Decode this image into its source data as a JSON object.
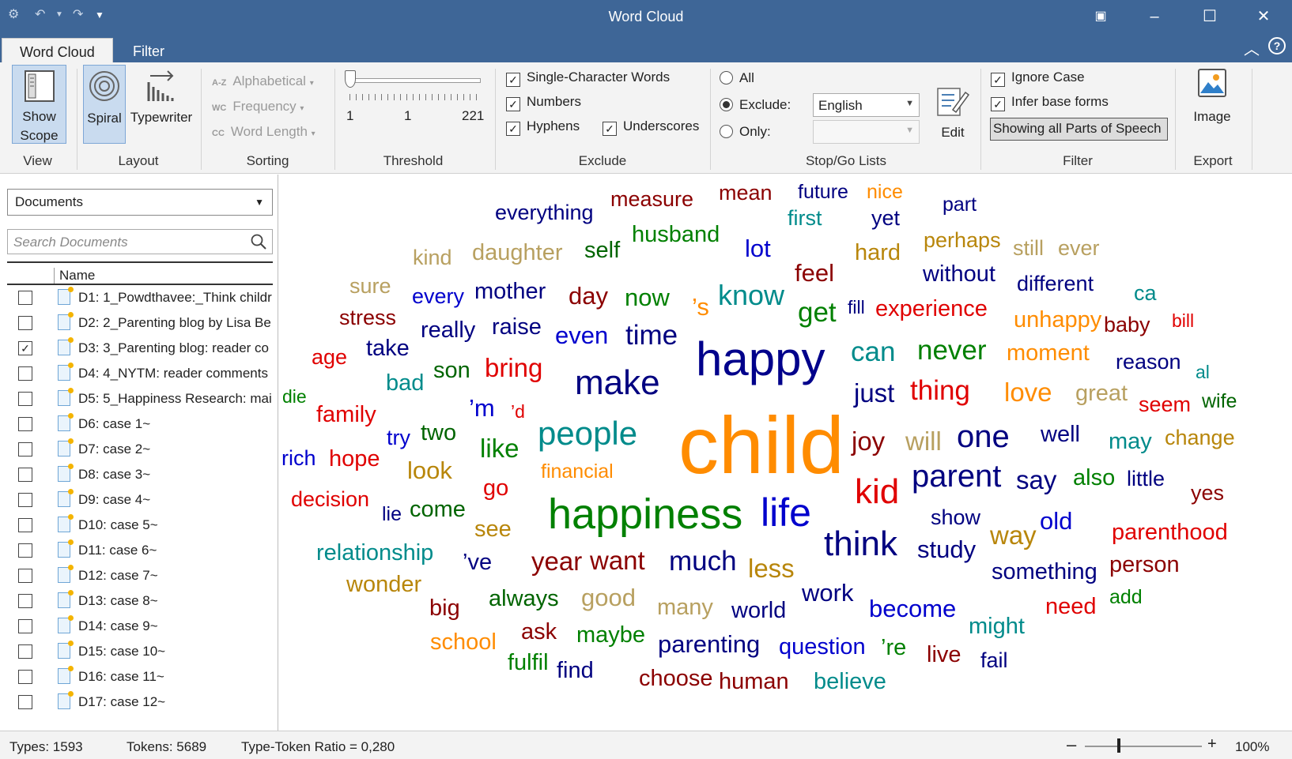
{
  "window": {
    "title": "Word Cloud"
  },
  "tabs": [
    {
      "label": "Word Cloud"
    },
    {
      "label": "Filter"
    }
  ],
  "ribbon": {
    "view": {
      "show_scope_label": "Show Scope",
      "group_label": "View"
    },
    "layout": {
      "spiral_label": "Spiral",
      "typewriter_label": "Typewriter",
      "group_label": "Layout"
    },
    "sorting": {
      "alphabetical": "Alphabetical",
      "frequency": "Frequency",
      "word_length": "Word Length",
      "group_label": "Sorting"
    },
    "threshold": {
      "min": "1",
      "value": "1",
      "max": "221",
      "group_label": "Threshold"
    },
    "exclude": {
      "single_char": "Single-Character Words",
      "numbers": "Numbers",
      "hyphens": "Hyphens",
      "underscores": "Underscores",
      "group_label": "Exclude"
    },
    "stopgo": {
      "all": "All",
      "exclude": "Exclude:",
      "only": "Only:",
      "exclude_list": "English",
      "only_list": "",
      "edit": "Edit",
      "group_label": "Stop/Go Lists"
    },
    "filter": {
      "ignore_case": "Ignore Case",
      "infer_base": "Infer base forms",
      "pos_button": "Showing all Parts of Speech",
      "group_label": "Filter"
    },
    "export": {
      "image": "Image",
      "group_label": "Export"
    }
  },
  "left": {
    "scope_select": "Documents",
    "search_placeholder": "Search Documents",
    "column_name": "Name",
    "documents": [
      {
        "name": "D1: 1_Powdthavee:_Think childr",
        "checked": false,
        "pdf": true
      },
      {
        "name": "D2: 2_Parenting blog by Lisa Be",
        "checked": false
      },
      {
        "name": "D3: 3_Parenting blog: reader co",
        "checked": true
      },
      {
        "name": "D4: 4_NYTM: reader comments",
        "checked": false
      },
      {
        "name": "D5: 5_Happiness Research: mai",
        "checked": false
      },
      {
        "name": "D6: case 1~",
        "checked": false
      },
      {
        "name": "D7: case 2~",
        "checked": false
      },
      {
        "name": "D8: case 3~",
        "checked": false
      },
      {
        "name": "D9: case 4~",
        "checked": false
      },
      {
        "name": "D10: case 5~",
        "checked": false
      },
      {
        "name": "D11: case 6~",
        "checked": false
      },
      {
        "name": "D12: case 7~",
        "checked": false
      },
      {
        "name": "D13: case 8~",
        "checked": false
      },
      {
        "name": "D14: case 9~",
        "checked": false
      },
      {
        "name": "D15: case 10~",
        "checked": false
      },
      {
        "name": "D16: case 11~",
        "checked": false
      },
      {
        "name": "D17: case 12~",
        "checked": false
      }
    ]
  },
  "cloud_words": [
    {
      "t": "child",
      "c": "#ff8c00"
    },
    {
      "t": "happy",
      "c": "#00008b"
    },
    {
      "t": "happiness",
      "c": "#008000"
    },
    {
      "t": "life",
      "c": "#0000cd"
    },
    {
      "t": "make",
      "c": "#000080"
    },
    {
      "t": "people",
      "c": "#008b8b"
    },
    {
      "t": "think",
      "c": "#000080"
    },
    {
      "t": "parent",
      "c": "#000080"
    },
    {
      "t": "kid",
      "c": "#e00000"
    },
    {
      "t": "everything",
      "c": "#000080"
    },
    {
      "t": "measure",
      "c": "#8b0000"
    },
    {
      "t": "mean",
      "c": "#8b0000"
    },
    {
      "t": "future",
      "c": "#000080"
    },
    {
      "t": "nice",
      "c": "#ff8c00"
    },
    {
      "t": "part",
      "c": "#000080"
    },
    {
      "t": "first",
      "c": "#008b8b"
    },
    {
      "t": "yet",
      "c": "#000080"
    },
    {
      "t": "husband",
      "c": "#008000"
    },
    {
      "t": "kind",
      "c": "#b8a060"
    },
    {
      "t": "daughter",
      "c": "#b8a060"
    },
    {
      "t": "self",
      "c": "#006400"
    },
    {
      "t": "lot",
      "c": "#0000cd"
    },
    {
      "t": "hard",
      "c": "#b8860b"
    },
    {
      "t": "perhaps",
      "c": "#b8860b"
    },
    {
      "t": "still",
      "c": "#b8a060"
    },
    {
      "t": "ever",
      "c": "#b8a060"
    },
    {
      "t": "feel",
      "c": "#8b0000"
    },
    {
      "t": "without",
      "c": "#000080"
    },
    {
      "t": "different",
      "c": "#000080"
    },
    {
      "t": "sure",
      "c": "#b8a060"
    },
    {
      "t": "every",
      "c": "#0000cd"
    },
    {
      "t": "mother",
      "c": "#000080"
    },
    {
      "t": "day",
      "c": "#8b0000"
    },
    {
      "t": "now",
      "c": "#008000"
    },
    {
      "t": "’s",
      "c": "#ff8c00"
    },
    {
      "t": "know",
      "c": "#008b8b"
    },
    {
      "t": "get",
      "c": "#008000"
    },
    {
      "t": "fill",
      "c": "#000080"
    },
    {
      "t": "experience",
      "c": "#e00000"
    },
    {
      "t": "ca",
      "c": "#008b8b"
    },
    {
      "t": "stress",
      "c": "#8b0000"
    },
    {
      "t": "really",
      "c": "#000080"
    },
    {
      "t": "raise",
      "c": "#000080"
    },
    {
      "t": "even",
      "c": "#0000cd"
    },
    {
      "t": "time",
      "c": "#000080"
    },
    {
      "t": "unhappy",
      "c": "#ff8c00"
    },
    {
      "t": "baby",
      "c": "#8b0000"
    },
    {
      "t": "bill",
      "c": "#e00000"
    },
    {
      "t": "age",
      "c": "#e00000"
    },
    {
      "t": "take",
      "c": "#000080"
    },
    {
      "t": "can",
      "c": "#008b8b"
    },
    {
      "t": "never",
      "c": "#008000"
    },
    {
      "t": "moment",
      "c": "#ff8c00"
    },
    {
      "t": "reason",
      "c": "#000080"
    },
    {
      "t": "al",
      "c": "#008b8b"
    },
    {
      "t": "bad",
      "c": "#008b8b"
    },
    {
      "t": "son",
      "c": "#006400"
    },
    {
      "t": "bring",
      "c": "#e00000"
    },
    {
      "t": "just",
      "c": "#000080"
    },
    {
      "t": "thing",
      "c": "#e00000"
    },
    {
      "t": "love",
      "c": "#ff8c00"
    },
    {
      "t": "great",
      "c": "#b8a060"
    },
    {
      "t": "seem",
      "c": "#e00000"
    },
    {
      "t": "wife",
      "c": "#006400"
    },
    {
      "t": "die",
      "c": "#008000"
    },
    {
      "t": "family",
      "c": "#e00000"
    },
    {
      "t": "’m",
      "c": "#0000cd"
    },
    {
      "t": "’d",
      "c": "#e00000"
    },
    {
      "t": "try",
      "c": "#0000cd"
    },
    {
      "t": "two",
      "c": "#006400"
    },
    {
      "t": "like",
      "c": "#008000"
    },
    {
      "t": "joy",
      "c": "#8b0000"
    },
    {
      "t": "will",
      "c": "#b8a060"
    },
    {
      "t": "one",
      "c": "#000080"
    },
    {
      "t": "well",
      "c": "#000080"
    },
    {
      "t": "may",
      "c": "#008b8b"
    },
    {
      "t": "change",
      "c": "#b8860b"
    },
    {
      "t": "rich",
      "c": "#0000cd"
    },
    {
      "t": "hope",
      "c": "#e00000"
    },
    {
      "t": "look",
      "c": "#b8860b"
    },
    {
      "t": "financial",
      "c": "#ff8c00"
    },
    {
      "t": "go",
      "c": "#e00000"
    },
    {
      "t": "say",
      "c": "#000080"
    },
    {
      "t": "also",
      "c": "#008000"
    },
    {
      "t": "little",
      "c": "#000080"
    },
    {
      "t": "yes",
      "c": "#8b0000"
    },
    {
      "t": "decision",
      "c": "#e00000"
    },
    {
      "t": "lie",
      "c": "#000080"
    },
    {
      "t": "come",
      "c": "#006400"
    },
    {
      "t": "show",
      "c": "#000080"
    },
    {
      "t": "old",
      "c": "#0000cd"
    },
    {
      "t": "parenthood",
      "c": "#e00000"
    },
    {
      "t": "see",
      "c": "#b8860b"
    },
    {
      "t": "way",
      "c": "#b8860b"
    },
    {
      "t": "study",
      "c": "#000080"
    },
    {
      "t": "relationship",
      "c": "#008b8b"
    },
    {
      "t": "’ve",
      "c": "#000080"
    },
    {
      "t": "year",
      "c": "#8b0000"
    },
    {
      "t": "want",
      "c": "#8b0000"
    },
    {
      "t": "much",
      "c": "#000080"
    },
    {
      "t": "less",
      "c": "#b8860b"
    },
    {
      "t": "something",
      "c": "#000080"
    },
    {
      "t": "person",
      "c": "#8b0000"
    },
    {
      "t": "wonder",
      "c": "#b8860b"
    },
    {
      "t": "work",
      "c": "#000080"
    },
    {
      "t": "add",
      "c": "#008000"
    },
    {
      "t": "big",
      "c": "#8b0000"
    },
    {
      "t": "always",
      "c": "#006400"
    },
    {
      "t": "good",
      "c": "#b8a060"
    },
    {
      "t": "many",
      "c": "#b8a060"
    },
    {
      "t": "world",
      "c": "#000080"
    },
    {
      "t": "become",
      "c": "#0000cd"
    },
    {
      "t": "need",
      "c": "#e00000"
    },
    {
      "t": "might",
      "c": "#008b8b"
    },
    {
      "t": "school",
      "c": "#ff8c00"
    },
    {
      "t": "ask",
      "c": "#8b0000"
    },
    {
      "t": "maybe",
      "c": "#008000"
    },
    {
      "t": "parenting",
      "c": "#000080"
    },
    {
      "t": "question",
      "c": "#0000cd"
    },
    {
      "t": "’re",
      "c": "#008000"
    },
    {
      "t": "live",
      "c": "#8b0000"
    },
    {
      "t": "fail",
      "c": "#000080"
    },
    {
      "t": "fulfil",
      "c": "#008000"
    },
    {
      "t": "find",
      "c": "#000080"
    },
    {
      "t": "choose",
      "c": "#8b0000"
    },
    {
      "t": "human",
      "c": "#8b0000"
    },
    {
      "t": "believe",
      "c": "#008b8b"
    }
  ],
  "status": {
    "types": "Types: 1593",
    "tokens": "Tokens: 5689",
    "ttr": "Type-Token Ratio = 0,280",
    "zoom": "100%"
  }
}
